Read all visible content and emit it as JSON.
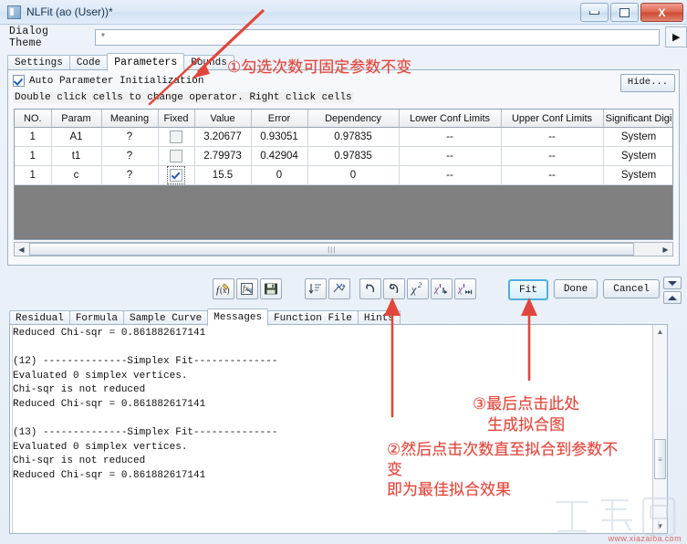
{
  "window": {
    "title": "NLFit (ao (User))*",
    "minimize_label": "minimize",
    "maximize_label": "maximize",
    "close_label": "X"
  },
  "theme": {
    "label": "Dialog Theme",
    "value": "*",
    "placeholder": "",
    "arrow_glyph": "▶"
  },
  "tabs": [
    {
      "label": "Settings",
      "active": false
    },
    {
      "label": "Code",
      "active": false
    },
    {
      "label": "Parameters",
      "active": true
    },
    {
      "label": "Bounds",
      "active": false
    }
  ],
  "panel": {
    "auto_init_label": "Auto Parameter Initialization",
    "auto_init_checked": true,
    "hide_button": "Hide...",
    "hint": "Double click cells to change operator. Right click cells"
  },
  "grid": {
    "columns": [
      "NO.",
      "Param",
      "Meaning",
      "Fixed",
      "Value",
      "Error",
      "Dependency",
      "Lower Conf Limits",
      "Upper Conf Limits",
      "Significant Digi",
      ""
    ],
    "rows": [
      {
        "no": "1",
        "param": "A1",
        "meaning": "?",
        "fixed": false,
        "value": "3.20677",
        "error": "0.93051",
        "dependency": "0.97835",
        "lower": "--",
        "upper": "--",
        "significant": "System"
      },
      {
        "no": "1",
        "param": "t1",
        "meaning": "?",
        "fixed": false,
        "value": "2.79973",
        "error": "0.42904",
        "dependency": "0.97835",
        "lower": "--",
        "upper": "--",
        "significant": "System"
      },
      {
        "no": "1",
        "param": "c",
        "meaning": "?",
        "fixed": true,
        "value": "15.5",
        "error": "0",
        "dependency": "0",
        "lower": "--",
        "upper": "--",
        "significant": "System"
      }
    ]
  },
  "toolbar": {
    "icons": [
      {
        "name": "new-function-icon",
        "glyph": "f(x)"
      },
      {
        "name": "open-function-file-icon",
        "glyph": "fx-doc"
      },
      {
        "name": "save-icon",
        "glyph": "floppy"
      },
      {
        "name": "sort-descending-icon",
        "glyph": "sort"
      },
      {
        "name": "expand-fit-icon",
        "glyph": "expand"
      },
      {
        "name": "undo-icon",
        "glyph": "undo"
      },
      {
        "name": "reset-icon",
        "glyph": "reset"
      },
      {
        "name": "chi-square-icon",
        "glyph": "x²"
      },
      {
        "name": "one-iteration-icon",
        "glyph": "step"
      },
      {
        "name": "fit-until-converged-icon",
        "glyph": "run"
      }
    ],
    "fit_label": "Fit",
    "done_label": "Done",
    "cancel_label": "Cancel",
    "spinner_down": "▼",
    "spinner_up": "▲"
  },
  "bottom_tabs": [
    {
      "label": "Residual",
      "active": false
    },
    {
      "label": "Formula",
      "active": false
    },
    {
      "label": "Sample Curve",
      "active": false
    },
    {
      "label": "Messages",
      "active": true
    },
    {
      "label": "Function File",
      "active": false
    },
    {
      "label": "Hints",
      "active": false
    }
  ],
  "messages": {
    "text": "Reduced Chi-sqr = 0.861882617141\n\n(12) --------------Simplex Fit--------------\nEvaluated 0 simplex vertices.\nChi-sqr is not reduced\nReduced Chi-sqr = 0.861882617141\n\n(13) --------------Simplex Fit--------------\nEvaluated 0 simplex vertices.\nChi-sqr is not reduced\nReduced Chi-sqr = 0.861882617141"
  },
  "annotations": [
    {
      "id": "anno-1",
      "text": "①勾选次数可固定参数不变"
    },
    {
      "id": "anno-3",
      "text": "③最后点击此处\n生成拟合图"
    },
    {
      "id": "anno-2",
      "text": "②然后点击次数直至拟合到参数不\n变\n即为最佳拟合效果"
    }
  ],
  "watermark": {
    "logo": "下载吧",
    "url": "www.xiazaiba.com"
  },
  "colors": {
    "annotation_red": "#e0473c",
    "accent_blue": "#4fb0d8",
    "grid_empty": "#808080"
  }
}
